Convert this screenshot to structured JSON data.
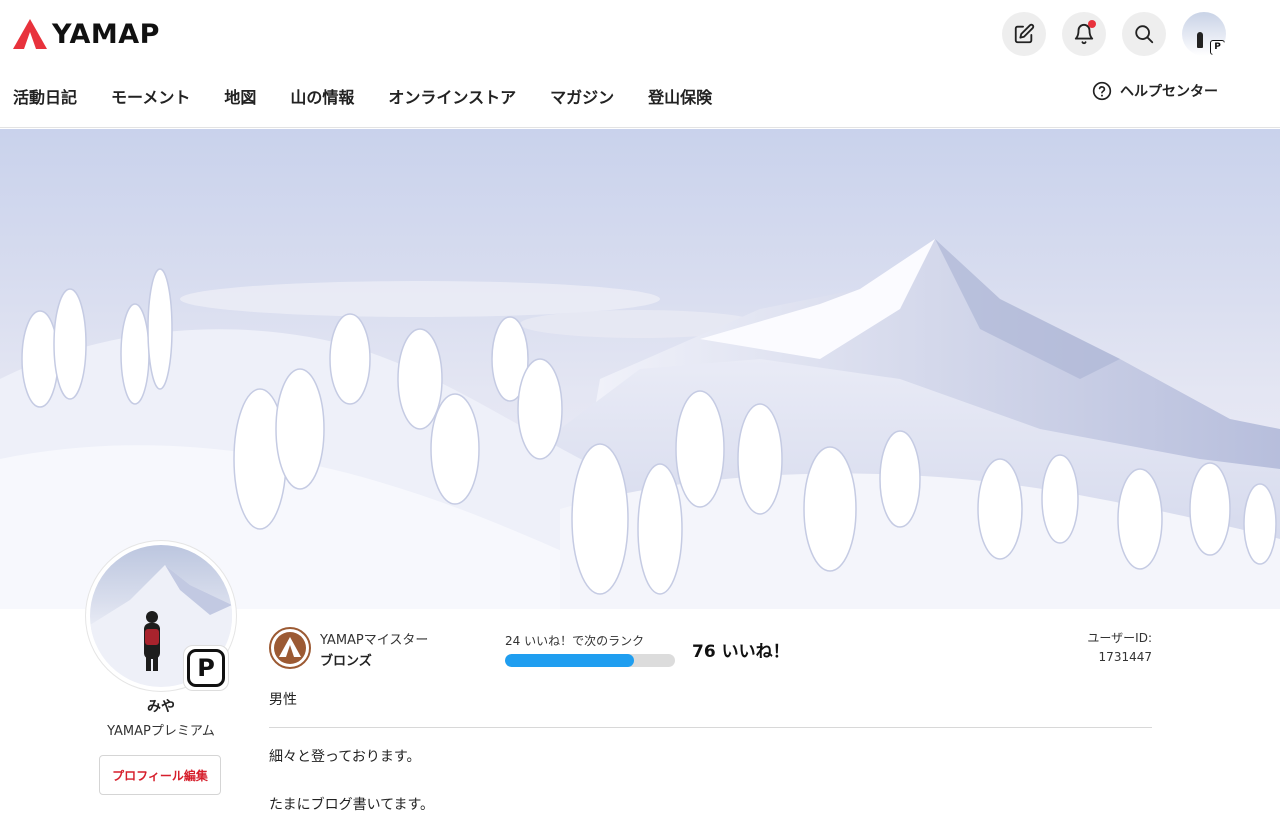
{
  "header": {
    "logo_text": "YAMAP",
    "brand_color": "#e8323c",
    "icons": [
      "edit-icon",
      "bell-icon",
      "search-icon"
    ],
    "avatar_badge": "P"
  },
  "nav": {
    "items": [
      {
        "label": "活動日記"
      },
      {
        "label": "モーメント"
      },
      {
        "label": "地図"
      },
      {
        "label": "山の情報"
      },
      {
        "label": "オンラインストア"
      },
      {
        "label": "マガジン"
      },
      {
        "label": "登山保険"
      }
    ],
    "help_label": "ヘルプセンター"
  },
  "profile": {
    "name": "みや",
    "plan": "YAMAPプレミアム",
    "premium_badge": "P",
    "edit_button": "プロフィール編集",
    "rank": {
      "title": "YAMAPマイスター",
      "name": "ブロンズ",
      "color": "#9c5a33"
    },
    "next_rank_text": "24 いいね！で次のランク",
    "progress_fraction": 0.76,
    "likes": "76 いいね！",
    "user_id_label": "ユーザーID:",
    "user_id": "1731447",
    "gender": "男性",
    "bio": [
      "細々と登っております。",
      "たまにブログ書いてます。"
    ]
  },
  "colors": {
    "accent_red": "#d61f2c",
    "progress_blue": "#1f9ef0"
  }
}
